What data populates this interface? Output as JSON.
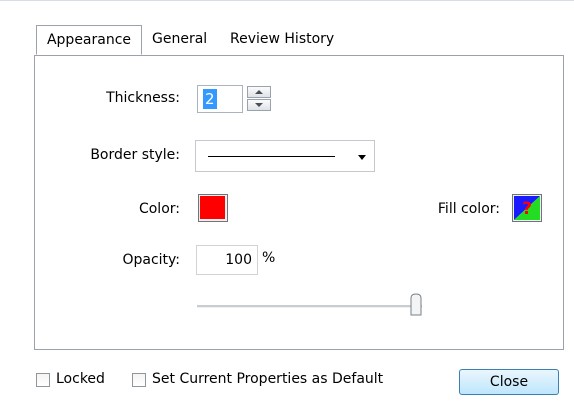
{
  "tabs": [
    {
      "label": "Appearance",
      "active": true
    },
    {
      "label": "General",
      "active": false
    },
    {
      "label": "Review History",
      "active": false
    }
  ],
  "appearance": {
    "thickness_label": "Thickness:",
    "thickness_value": "2",
    "border_style_label": "Border style:",
    "border_style_value": "solid",
    "color_label": "Color:",
    "color_value": "#ff0000",
    "fill_color_label": "Fill color:",
    "fill_color_icon": "no-fill-question-icon",
    "opacity_label": "Opacity:",
    "opacity_value": "100",
    "opacity_unit": "%",
    "opacity_slider_percent": 100
  },
  "footer": {
    "locked_label": "Locked",
    "locked_checked": false,
    "default_label": "Set Current Properties as Default",
    "default_checked": false,
    "close_label": "Close"
  },
  "colors": {
    "accent": "#3399ff",
    "border": "#9aa3ad"
  }
}
